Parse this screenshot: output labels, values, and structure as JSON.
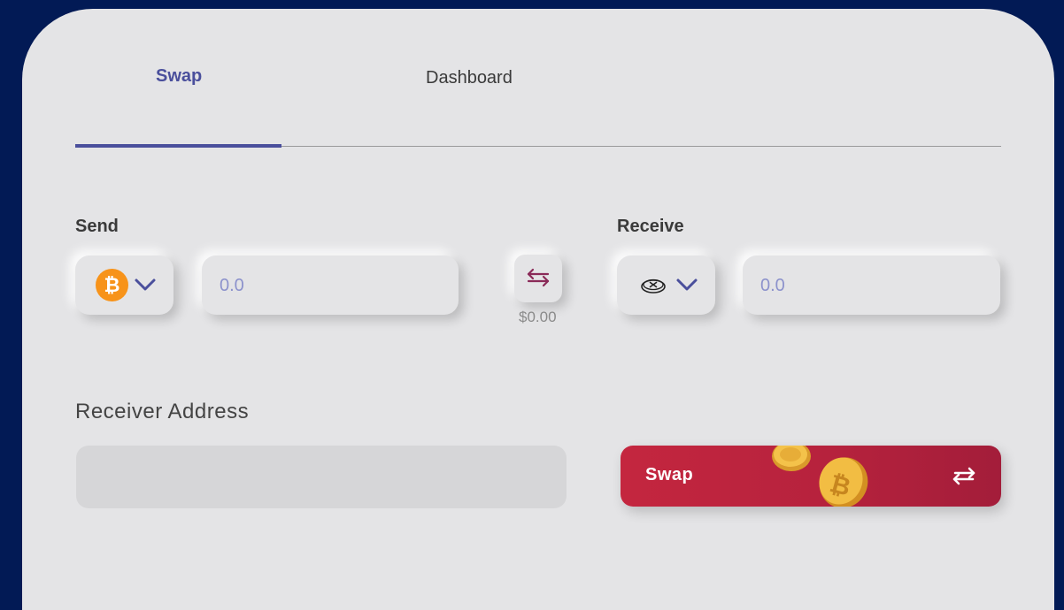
{
  "tabs": {
    "swap_label": "Swap",
    "dashboard_label": "Dashboard"
  },
  "send": {
    "label": "Send",
    "coin_icon": "bitcoin-icon",
    "coin_symbol": "₿",
    "amount_placeholder": "0.0"
  },
  "swap_direction": {
    "icon": "swap-arrows-icon",
    "usd_value": "$0.00"
  },
  "receive": {
    "label": "Receive",
    "coin_icon": "token-icon",
    "amount_placeholder": "0.0"
  },
  "receiver": {
    "label": "Receiver Address",
    "placeholder": ""
  },
  "swap_button": {
    "label": "Swap",
    "icon": "swap-arrows-icon"
  },
  "colors": {
    "background": "#021a55",
    "card": "#e4e4e6",
    "accent": "#4a4f9c",
    "swap_button": "#b6223d",
    "bitcoin": "#f7931a"
  }
}
